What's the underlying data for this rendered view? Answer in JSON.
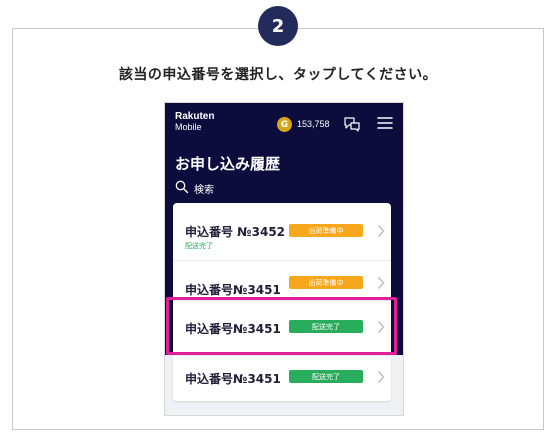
{
  "step": {
    "number": "2"
  },
  "instruction": "該当の申込番号を選択し、タップしてください。",
  "app": {
    "brand_name": "Rakuten",
    "brand_sub": "Mobile",
    "coin_symbol": "G",
    "points": "153,758",
    "page_title": "お申し込み履歴",
    "search_label": "検索"
  },
  "orders": [
    {
      "number": "申込番号 №3452",
      "status": "出荷準備中",
      "status_type": "preparing",
      "sub_status": "配送完了"
    },
    {
      "number": "申込番号№3451",
      "status": "出荷準備中",
      "status_type": "preparing"
    },
    {
      "number": "申込番号№3451",
      "status": "配送完了",
      "status_type": "delivered"
    },
    {
      "number": "申込番号№3451",
      "status": "配送完了",
      "status_type": "delivered"
    }
  ],
  "colors": {
    "header_bg": "#0c0d3d",
    "badge_preparing": "#f7a71b",
    "badge_delivered": "#27ad5c",
    "highlight": "#e21f9a",
    "step_badge": "#232a5c"
  }
}
